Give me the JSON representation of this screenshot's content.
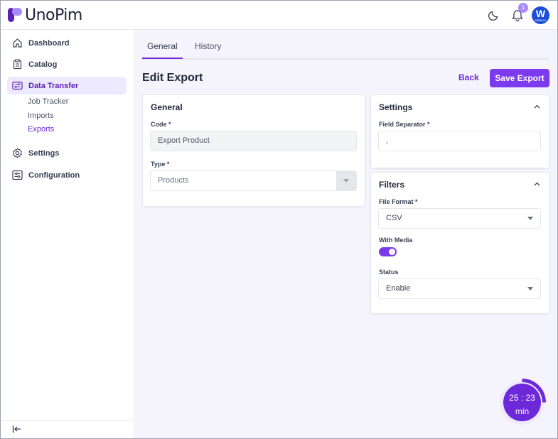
{
  "app": {
    "name": "UnoPim"
  },
  "header": {
    "notification_count": "1",
    "avatar_initial": "W",
    "avatar_caption": "WEBKUL"
  },
  "sidebar": {
    "items": [
      {
        "label": "Dashboard",
        "icon": "home-icon"
      },
      {
        "label": "Catalog",
        "icon": "clipboard-icon"
      },
      {
        "label": "Data Transfer",
        "icon": "transfer-icon",
        "active": true
      },
      {
        "label": "Settings",
        "icon": "gear-icon"
      },
      {
        "label": "Configuration",
        "icon": "sliders-icon"
      }
    ],
    "sub_items": [
      {
        "label": "Job Tracker"
      },
      {
        "label": "Imports"
      },
      {
        "label": "Exports",
        "active": true
      }
    ]
  },
  "tabs": [
    {
      "label": "General",
      "active": true
    },
    {
      "label": "History"
    }
  ],
  "page": {
    "title": "Edit Export",
    "back_label": "Back",
    "save_label": "Save Export"
  },
  "general_card": {
    "title": "General",
    "code_label": "Code *",
    "code_value": "Export Product",
    "type_label": "Type *",
    "type_value": "Products"
  },
  "settings_card": {
    "title": "Settings",
    "separator_label": "Field Separator *",
    "separator_value": ","
  },
  "filters_card": {
    "title": "Filters",
    "format_label": "File Format *",
    "format_value": "CSV",
    "media_label": "With Media",
    "media_enabled": true,
    "status_label": "Status",
    "status_value": "Enable"
  },
  "timer": {
    "time": "25 : 23",
    "unit": "min"
  },
  "colors": {
    "accent": "#7c3aed",
    "accent_dark": "#6d28d9",
    "active_bg": "#ede9fe",
    "main_bg": "#f5f3fb"
  }
}
